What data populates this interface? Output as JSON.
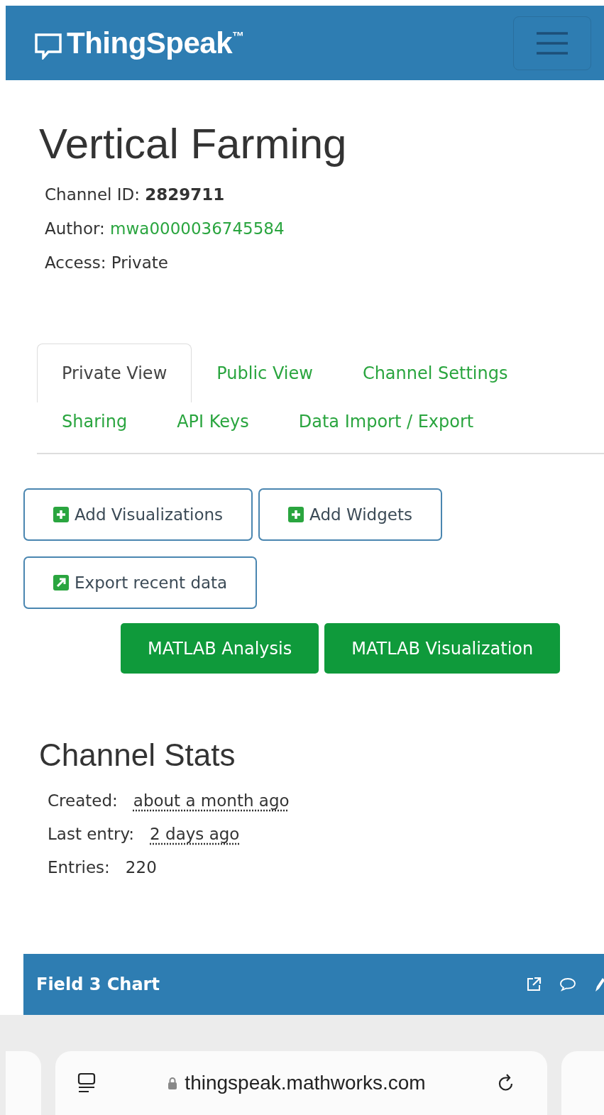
{
  "navbar": {
    "brand": "ThingSpeak$^{™}$"
  },
  "channel": {
    "title": "Vertical Farming",
    "meta": [
      {
        "label": "Channel ID: ",
        "value": "2829711",
        "kind": "bold"
      },
      {
        "label": "Author: ",
        "value": "mwa0000036745584",
        "kind": "link"
      },
      {
        "label": "Access: ",
        "value": "Private",
        "kind": "plain"
      }
    ]
  },
  "tab_rows": [
    [
      {
        "label": "Private View",
        "selected": true
      },
      {
        "label": "Public View",
        "selected": false
      },
      {
        "label": "Channel Settings",
        "selected": false
      }
    ],
    [
      {
        "label": "Sharing",
        "selected": false
      },
      {
        "label": "API Keys",
        "selected": false
      },
      {
        "label": "Data Import / Export",
        "selected": false
      }
    ]
  ],
  "tool_buttons": [
    {
      "label": "Add Visualizations",
      "kind": "plus"
    },
    {
      "label": "Add Widgets",
      "kind": "plus"
    },
    {
      "label": "Export recent data",
      "kind": "export"
    }
  ],
  "matlab_buttons": [
    "MATLAB Analysis",
    "MATLAB Visualization"
  ],
  "stats": {
    "title": "Channel Stats",
    "items": [
      {
        "label": "Created:",
        "value": "about a month ago",
        "kind": "time"
      },
      {
        "label": "Last entry:",
        "value": "2 days ago",
        "kind": "time"
      },
      {
        "label": "Entries:",
        "value": "220",
        "kind": "plain"
      }
    ]
  },
  "chart_panel": {
    "title": "Field 3 Chart"
  },
  "browser": {
    "url": "thingspeak.mathworks.com"
  }
}
